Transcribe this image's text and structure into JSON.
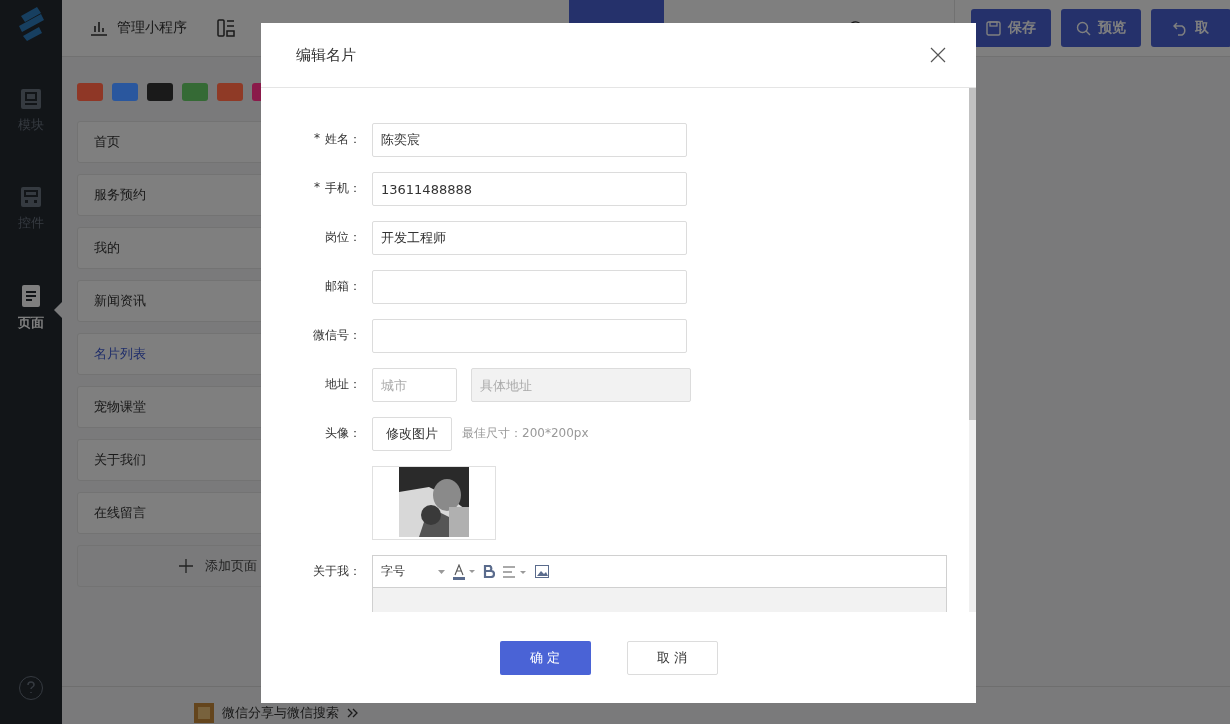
{
  "sidebar": {
    "items": [
      {
        "label": "模块",
        "kind": "block",
        "selected": false
      },
      {
        "label": "控件",
        "kind": "widget",
        "selected": false
      },
      {
        "label": "页面",
        "kind": "page",
        "selected": true
      }
    ]
  },
  "topbar": {
    "links": [
      {
        "label": "管理小程序",
        "kind": "chart"
      },
      {
        "kind": "layout"
      }
    ],
    "actions": [
      {
        "label": "保存",
        "kind": "save"
      },
      {
        "label": "预览",
        "kind": "search"
      },
      {
        "label": "取",
        "kind": "undo"
      }
    ]
  },
  "color_swatches": [
    {
      "color": "#8f3726"
    },
    {
      "color": "#2a579e"
    },
    {
      "color": "#1a1a1a"
    },
    {
      "color": "#356a35"
    },
    {
      "color": "#8f3a26"
    },
    {
      "color": "#8a1a4a"
    }
  ],
  "pages": [
    {
      "label": "首页",
      "selected": false
    },
    {
      "label": "服务预约",
      "selected": false
    },
    {
      "label": "我的",
      "selected": false
    },
    {
      "label": "新闻资讯",
      "selected": false
    },
    {
      "label": "名片列表",
      "selected": true
    },
    {
      "label": "宠物课堂",
      "selected": false
    },
    {
      "label": "关于我们",
      "selected": false
    },
    {
      "label": "在线留言",
      "selected": false
    }
  ],
  "add_page": "添加页面",
  "footer_link": "微信分享与微信搜索",
  "dialog": {
    "title": "编辑名片",
    "fields": [
      {
        "label": "姓名：",
        "required_mark": "*",
        "value": "陈奕宸"
      },
      {
        "label": "手机：",
        "required_mark": "*",
        "value": "13611488888"
      },
      {
        "label": "岗位：",
        "value": "开发工程师"
      },
      {
        "label": "邮箱："
      },
      {
        "label": "微信号："
      }
    ],
    "address": {
      "label": "地址：",
      "city_placeholder": "城市",
      "detail_placeholder": "具体地址",
      "detail_disabled": true
    },
    "avatar": {
      "label": "头像：",
      "button": "修改图片",
      "hint": "最佳尺寸：200*200px"
    },
    "about": {
      "label": "关于我：",
      "font_size": "字号"
    },
    "buttons": [
      {
        "label": "确 定",
        "kind": "primary"
      },
      {
        "label": "取 消",
        "kind": "default"
      }
    ]
  }
}
